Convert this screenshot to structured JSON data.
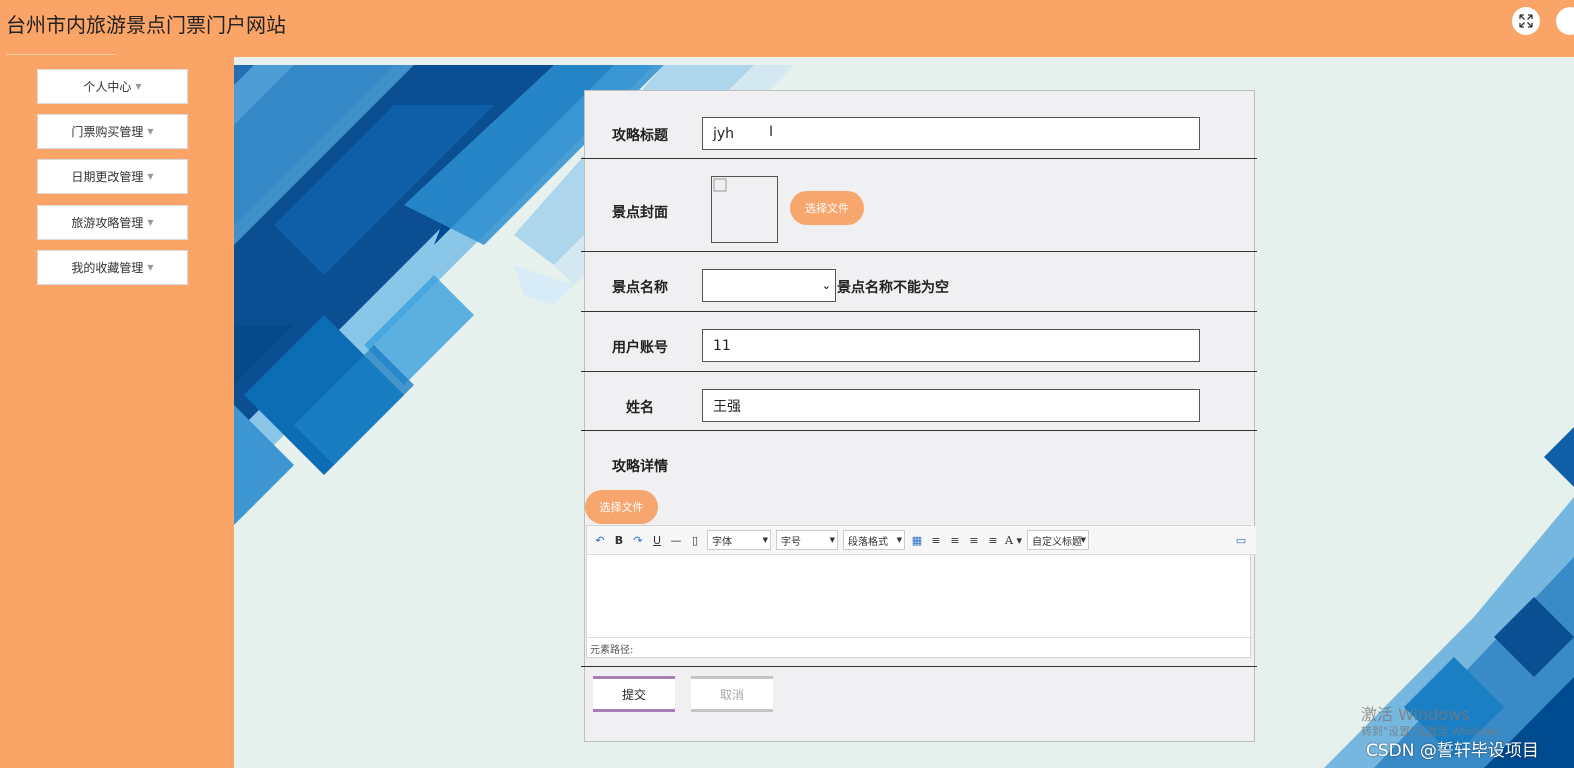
{
  "header": {
    "site_title": "台州市内旅游景点门票门户网站"
  },
  "sidebar": {
    "items": [
      {
        "label": "个人中心"
      },
      {
        "label": "门票购买管理"
      },
      {
        "label": "日期更改管理"
      },
      {
        "label": "旅游攻略管理"
      },
      {
        "label": "我的收藏管理"
      }
    ]
  },
  "form": {
    "title_label": "攻略标题",
    "title_value": "jyh",
    "cover_label": "景点封面",
    "choose_file": "选择文件",
    "spot_label": "景点名称",
    "spot_error": "景点名称不能为空",
    "account_label": "用户账号",
    "account_value": "11",
    "name_label": "姓名",
    "name_value": "王强",
    "detail_label": "攻略详情",
    "submit": "提交",
    "cancel": "取消"
  },
  "editor": {
    "font_select": "字体",
    "size_select": "字号",
    "para_select": "段落格式",
    "custom_title": "自定义标题",
    "path_label": "元素路径:"
  },
  "watermarks": {
    "activate": "激活 Windows",
    "activate_sub": "转到\"设置\"以激活 Windows",
    "csdn": "CSDN @誓轩毕设项目"
  },
  "colors": {
    "accent": "#fba467",
    "button": "#f7a66d"
  }
}
